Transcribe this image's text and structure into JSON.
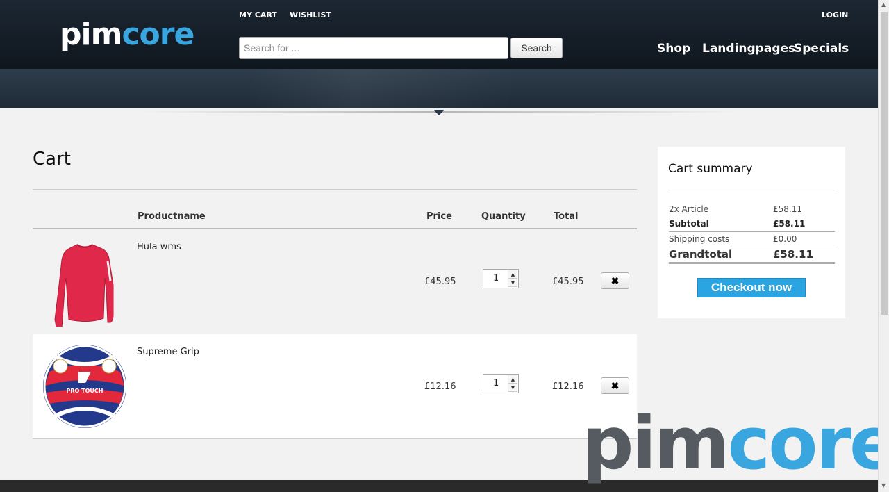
{
  "header": {
    "logo_part1": "pim",
    "logo_part2": "core",
    "top_links": {
      "my_cart": "MY CART",
      "wishlist": "WISHLIST",
      "login": "LOGIN"
    },
    "search": {
      "placeholder": "Search for ...",
      "value": "",
      "button": "Search"
    },
    "nav": {
      "shop": "Shop",
      "landingpages": "Landingpages",
      "specials": "Specials"
    }
  },
  "cart": {
    "title": "Cart",
    "columns": {
      "product": "Productname",
      "price": "Price",
      "quantity": "Quantity",
      "total": "Total"
    },
    "items": [
      {
        "name": "Hula wms",
        "price": "£45.95",
        "quantity": "1",
        "total": "£45.95",
        "remove_icon": "close-icon",
        "image": "red-longsleeve-shirt"
      },
      {
        "name": "Supreme Grip",
        "price": "£12.16",
        "quantity": "1",
        "total": "£12.16",
        "remove_icon": "close-icon",
        "image": "pro-touch-handball",
        "ball_text": "PRO TOUCH"
      }
    ]
  },
  "summary": {
    "title": "Cart summary",
    "article_label": "2x Article",
    "article_value": "£58.11",
    "subtotal_label": "Subtotal",
    "subtotal_value": "£58.11",
    "shipping_label": "Shipping costs",
    "shipping_value": "£0.00",
    "grandtotal_label": "Grandtotal",
    "grandtotal_value": "£58.11",
    "checkout": "Checkout now"
  },
  "watermark": {
    "part1": "pim",
    "part2": "core"
  },
  "colors": {
    "accent": "#2aa5e2",
    "header": "#121b24"
  }
}
